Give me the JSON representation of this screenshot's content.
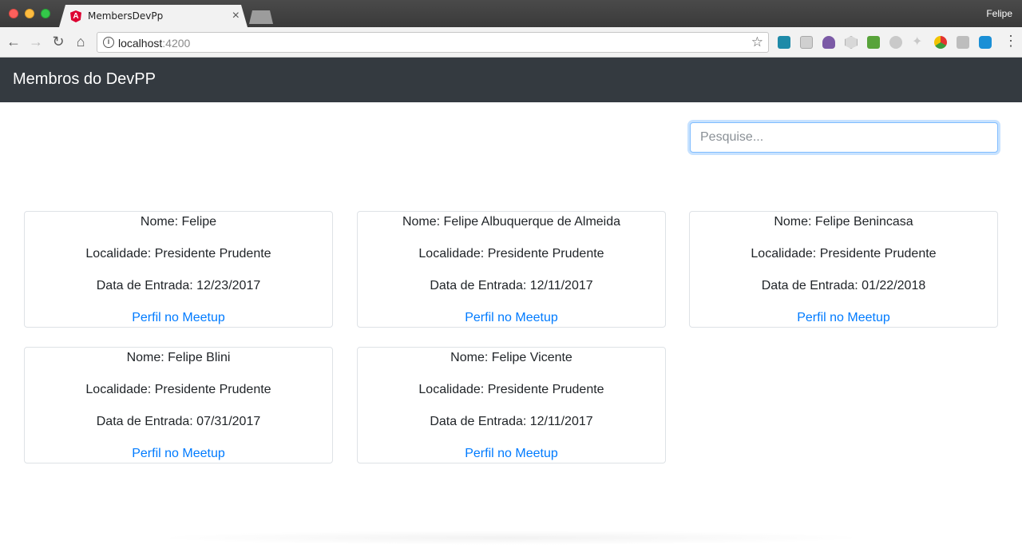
{
  "browser": {
    "tab_title": "MembersDevPp",
    "tab_close": "×",
    "profile_name": "Felipe",
    "url_host": "localhost",
    "url_port": ":4200",
    "icons": {
      "back": "arrow-left-icon",
      "forward": "arrow-right-icon",
      "reload": "reload-icon",
      "home": "home-icon",
      "info": "info-icon",
      "bookmark": "star-icon"
    }
  },
  "navbar": {
    "brand": "Membros do DevPP",
    "background": "#343a40"
  },
  "search": {
    "placeholder": "Pesquise...",
    "value": ""
  },
  "link_color": "#007bff",
  "members": [
    {
      "nome": "Nome: Felipe",
      "localidade": "Localidade: Presidente Prudente",
      "data": "Data de Entrada: 12/23/2017",
      "link": "Perfil no Meetup"
    },
    {
      "nome": "Nome: Felipe Albuquerque de Almeida",
      "localidade": "Localidade: Presidente Prudente",
      "data": "Data de Entrada: 12/11/2017",
      "link": "Perfil no Meetup"
    },
    {
      "nome": "Nome: Felipe Benincasa",
      "localidade": "Localidade: Presidente Prudente",
      "data": "Data de Entrada: 01/22/2018",
      "link": "Perfil no Meetup"
    },
    {
      "nome": "Nome: Felipe Blini",
      "localidade": "Localidade: Presidente Prudente",
      "data": "Data de Entrada: 07/31/2017",
      "link": "Perfil no Meetup"
    },
    {
      "nome": "Nome: Felipe Vicente",
      "localidade": "Localidade: Presidente Prudente",
      "data": "Data de Entrada: 12/11/2017",
      "link": "Perfil no Meetup"
    }
  ]
}
